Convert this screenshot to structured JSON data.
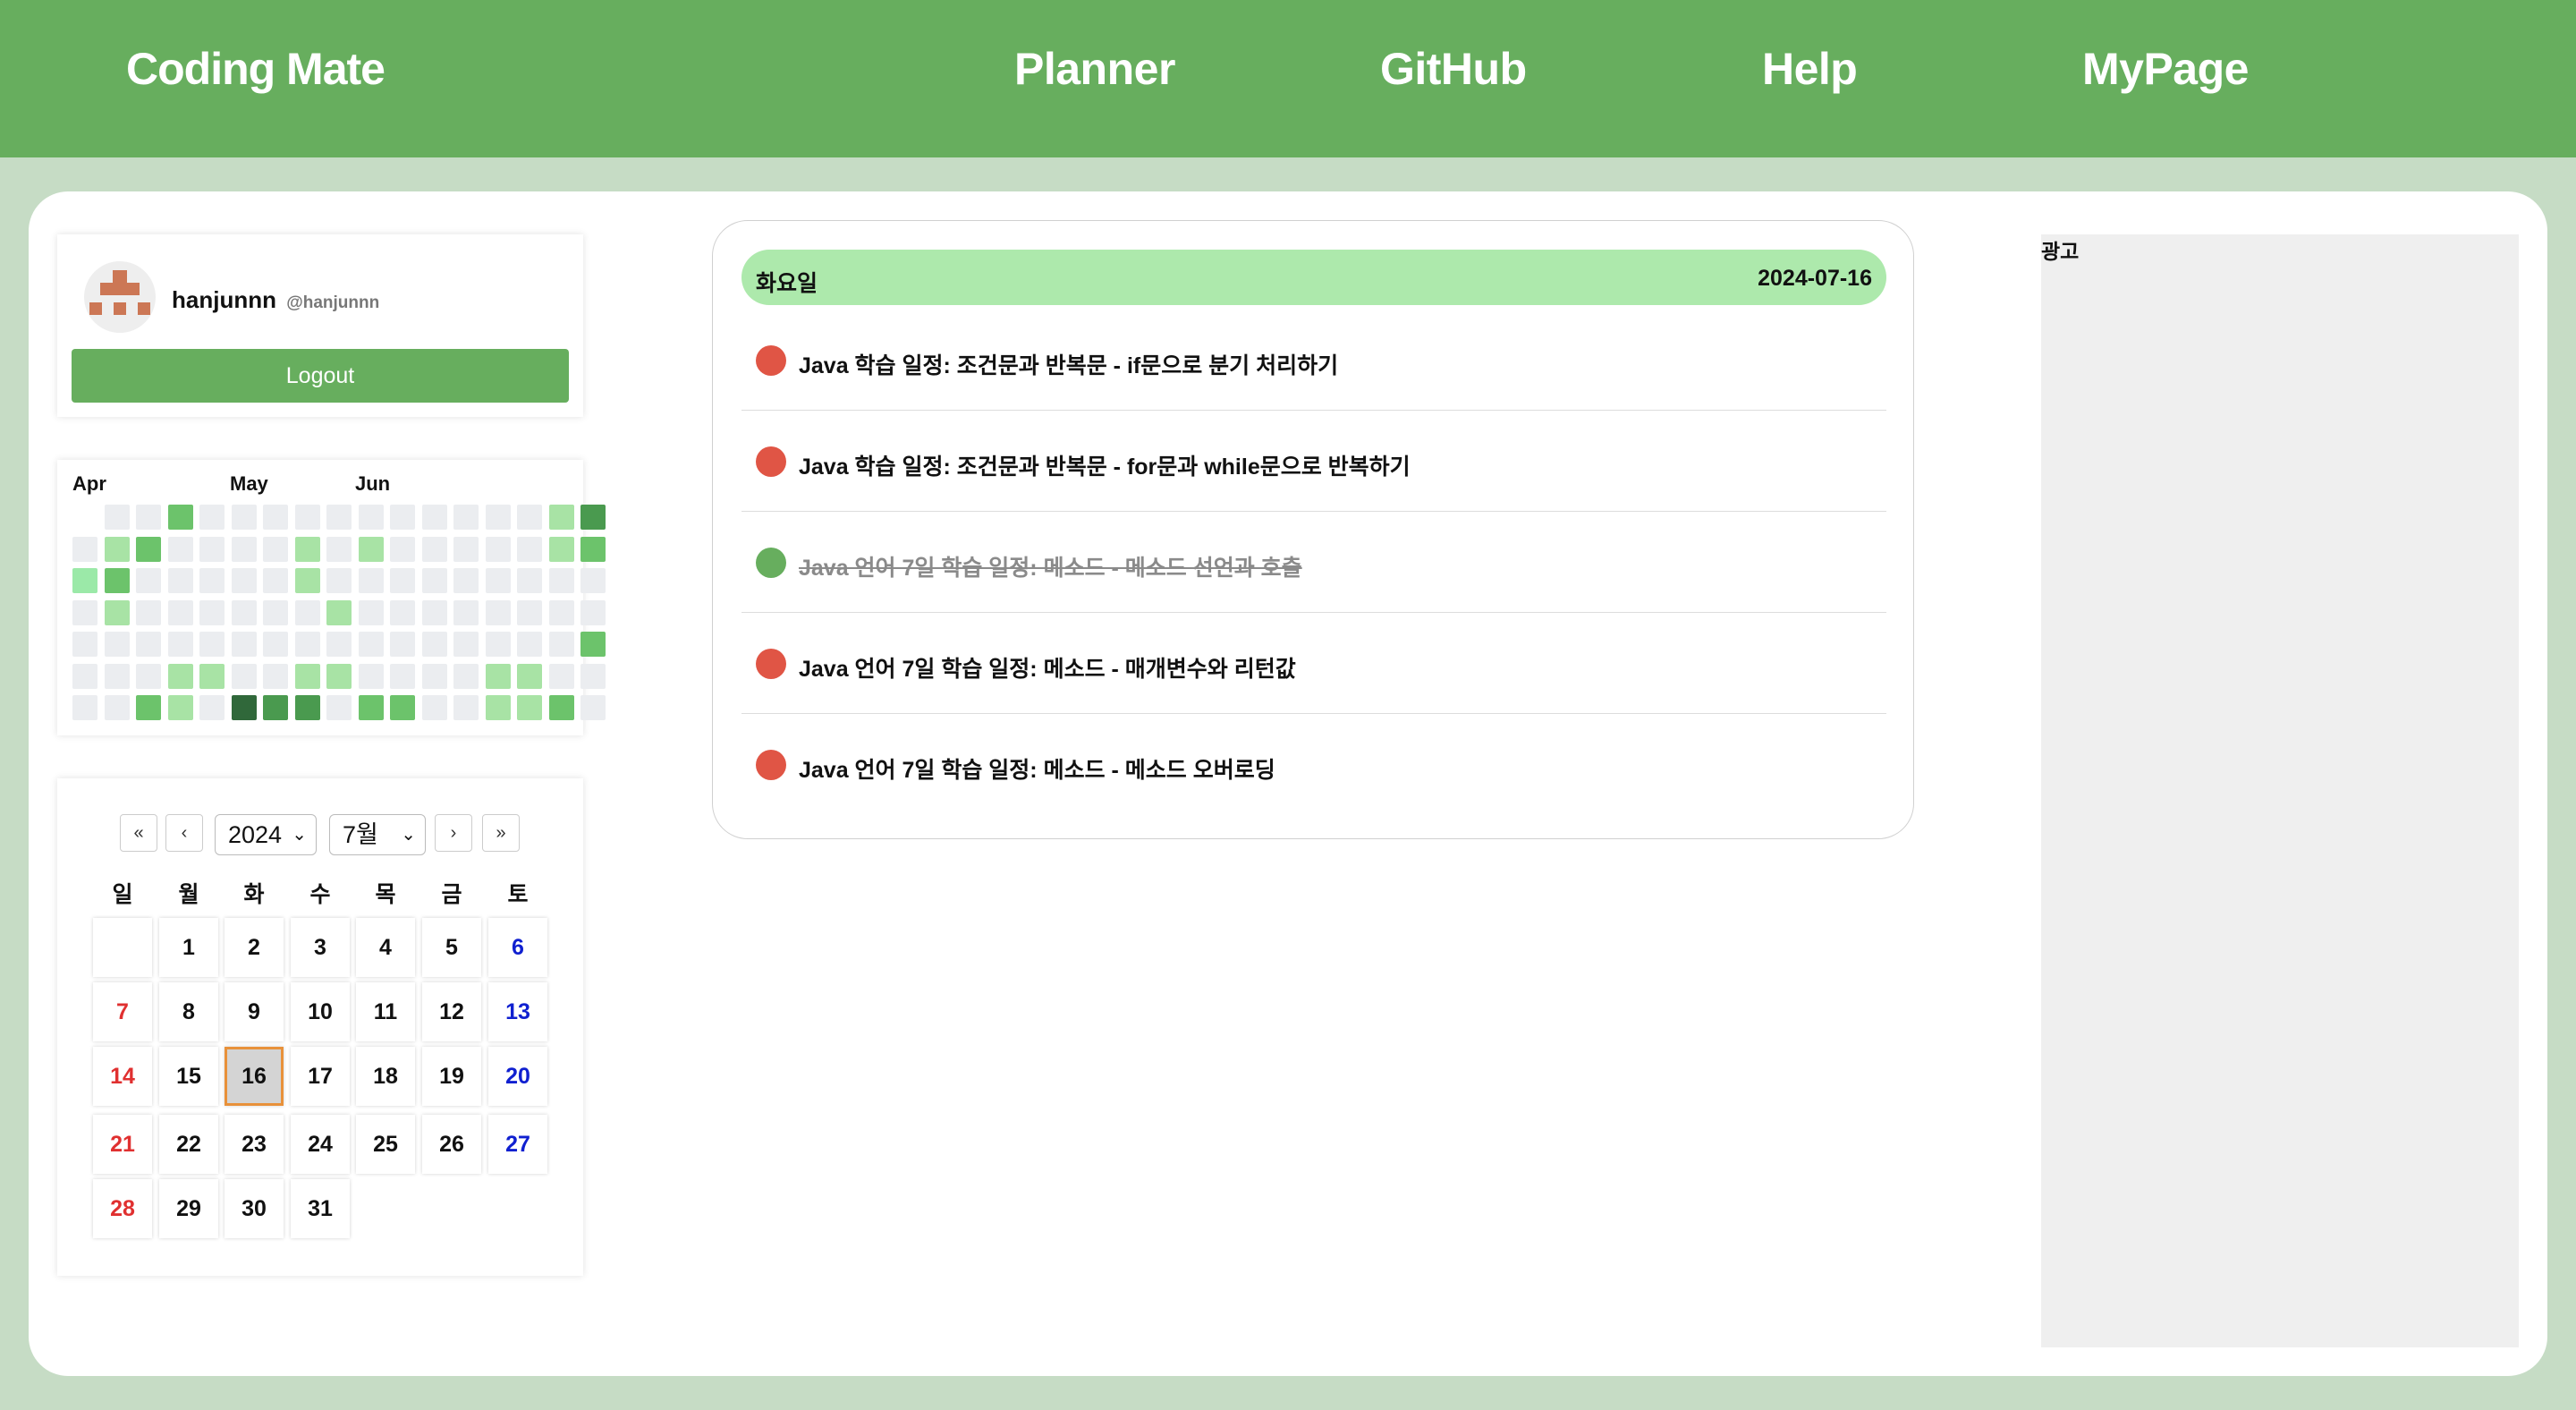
{
  "header": {
    "brand": "Coding Mate",
    "nav": [
      "Planner",
      "GitHub",
      "Help",
      "MyPage"
    ]
  },
  "profile": {
    "username": "hanjunnn",
    "handle": "@hanjunnn",
    "logout_label": "Logout"
  },
  "contributions": {
    "months": [
      "Apr",
      "May",
      "Jun"
    ],
    "levels": [
      [
        0,
        0,
        1,
        0,
        0,
        0,
        0
      ],
      [
        0,
        2,
        3,
        2,
        0,
        0,
        0
      ],
      [
        0,
        3,
        0,
        0,
        0,
        0,
        3
      ],
      [
        3,
        0,
        0,
        0,
        0,
        2,
        2
      ],
      [
        0,
        0,
        0,
        0,
        0,
        2,
        0
      ],
      [
        0,
        0,
        0,
        0,
        0,
        0,
        5
      ],
      [
        0,
        0,
        0,
        0,
        0,
        0,
        4
      ],
      [
        0,
        2,
        2,
        0,
        0,
        2,
        4
      ],
      [
        0,
        0,
        0,
        2,
        0,
        2,
        0
      ],
      [
        0,
        2,
        0,
        0,
        0,
        0,
        3
      ],
      [
        0,
        0,
        0,
        0,
        0,
        0,
        3
      ],
      [
        0,
        0,
        0,
        0,
        0,
        0,
        0
      ],
      [
        0,
        0,
        0,
        0,
        0,
        0,
        0
      ],
      [
        0,
        0,
        0,
        0,
        0,
        2,
        2
      ],
      [
        0,
        0,
        0,
        0,
        0,
        2,
        2
      ],
      [
        2,
        2,
        0,
        0,
        0,
        0,
        3
      ],
      [
        4,
        3,
        0,
        0,
        3,
        0,
        0
      ]
    ],
    "colors": [
      "#ebedf0",
      "#9be9a8",
      "#a8e3a5",
      "#6cc36b",
      "#4a9a4f",
      "#30683a"
    ]
  },
  "calendar": {
    "year": "2024",
    "month": "7월",
    "nav": [
      "«",
      "‹",
      "›",
      "»"
    ],
    "weekdays": [
      "일",
      "월",
      "화",
      "수",
      "목",
      "금",
      "토"
    ],
    "days": [
      "",
      "1",
      "2",
      "3",
      "4",
      "5",
      "6",
      "7",
      "8",
      "9",
      "10",
      "11",
      "12",
      "13",
      "14",
      "15",
      "16",
      "17",
      "18",
      "19",
      "20",
      "21",
      "22",
      "23",
      "24",
      "25",
      "26",
      "27",
      "28",
      "29",
      "30",
      "31"
    ],
    "selected": "16"
  },
  "schedule": {
    "day_name": "화요일",
    "date": "2024-07-16",
    "tasks": [
      {
        "text": "Java 학습 일정: 조건문과 반복문 - if문으로 분기 처리하기",
        "done": false
      },
      {
        "text": "Java 학습 일정: 조건문과 반복문 - for문과 while문으로 반복하기",
        "done": false
      },
      {
        "text": "Java 언어 7일 학습 일정: 메소드 - 메소드 선언과 호출",
        "done": true
      },
      {
        "text": "Java 언어 7일 학습 일정: 메소드 - 매개변수와 리턴값",
        "done": false
      },
      {
        "text": "Java 언어 7일 학습 일정: 메소드 - 메소드 오버로딩",
        "done": false
      }
    ],
    "colors": {
      "pending": "#e05545",
      "done": "#67ae5e"
    }
  },
  "ad": {
    "label": "광고"
  }
}
